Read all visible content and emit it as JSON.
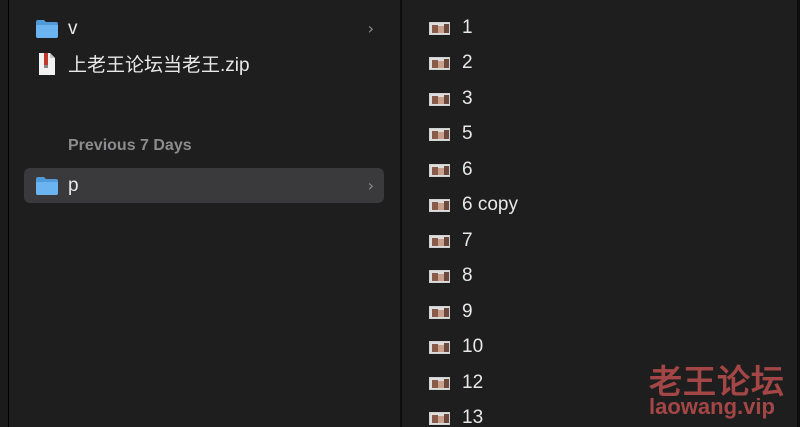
{
  "left_column": {
    "items": [
      {
        "label": "v",
        "icon": "folder-icon",
        "has_chevron": true,
        "selected": false
      },
      {
        "label": "上老王论坛当老王.zip",
        "icon": "zip-file-icon",
        "has_chevron": false,
        "selected": false
      }
    ],
    "section_header": "Previous 7 Days",
    "section_items": [
      {
        "label": "p",
        "icon": "folder-icon",
        "has_chevron": true,
        "selected": true
      }
    ],
    "chevron_glyph": "›"
  },
  "right_column": {
    "files": [
      {
        "name": "1",
        "icon": "image-thumbnail-icon"
      },
      {
        "name": "2",
        "icon": "image-thumbnail-icon"
      },
      {
        "name": "3",
        "icon": "image-thumbnail-icon"
      },
      {
        "name": "5",
        "icon": "image-thumbnail-icon"
      },
      {
        "name": "6",
        "icon": "image-thumbnail-icon"
      },
      {
        "name": "6 copy",
        "icon": "image-thumbnail-icon"
      },
      {
        "name": "7",
        "icon": "image-thumbnail-icon"
      },
      {
        "name": "8",
        "icon": "image-thumbnail-icon"
      },
      {
        "name": "9",
        "icon": "image-thumbnail-icon"
      },
      {
        "name": "10",
        "icon": "image-thumbnail-icon"
      },
      {
        "name": "12",
        "icon": "image-thumbnail-icon"
      },
      {
        "name": "13",
        "icon": "image-thumbnail-icon"
      }
    ]
  },
  "watermark": {
    "text_cn": "老王论坛",
    "text_en": "laowang.vip"
  },
  "colors": {
    "background": "#1e1e1e",
    "selection": "#3a3a3c",
    "folder_blue": "#5aa6e8",
    "section_header": "#8c8c8e",
    "watermark": "#b04a4a"
  }
}
